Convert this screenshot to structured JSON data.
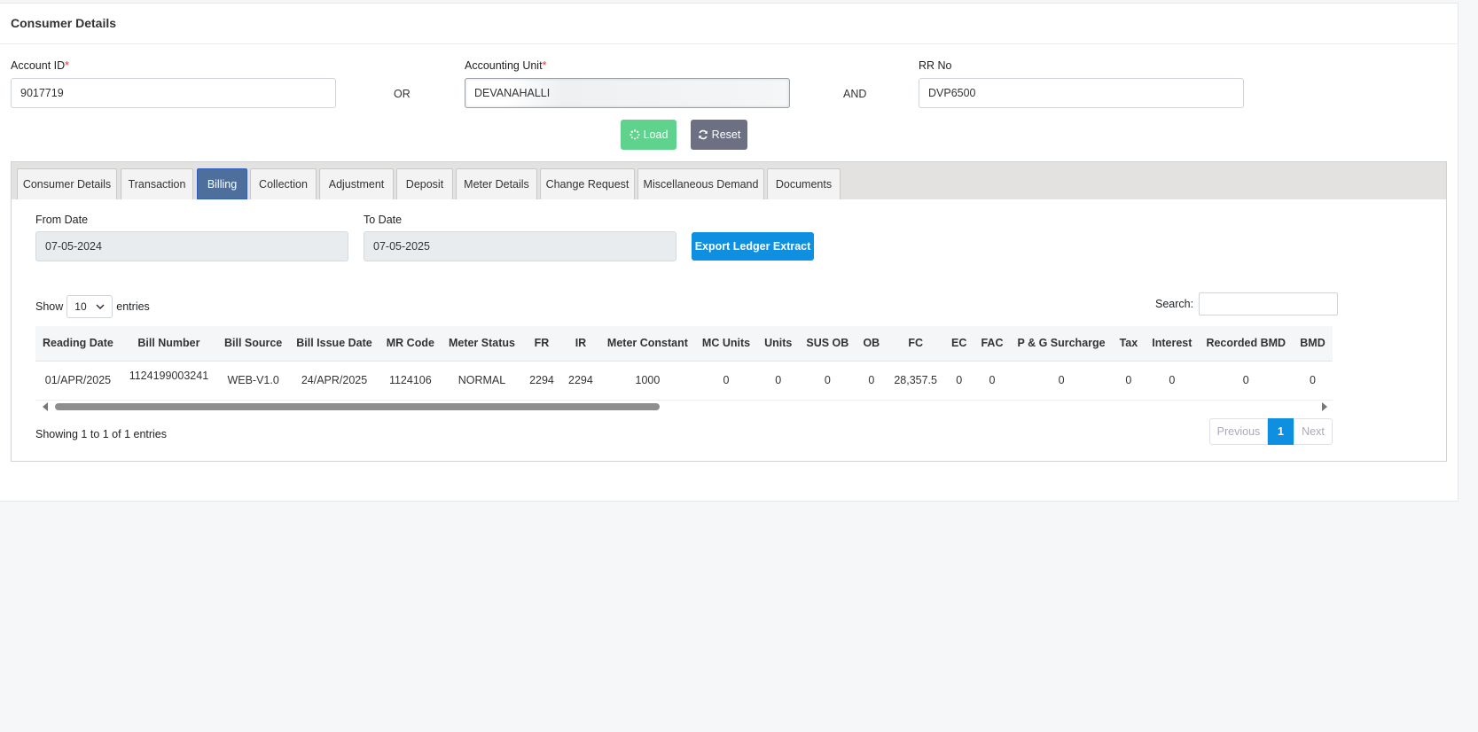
{
  "header": {
    "title": "Consumer Details"
  },
  "form": {
    "account_id": {
      "label": "Account ID",
      "required": "*",
      "value": "9017719"
    },
    "or_label": "OR",
    "accounting_unit": {
      "label": "Accounting Unit",
      "required": "*",
      "value": "DEVANAHALLI"
    },
    "and_label": "AND",
    "rr_no": {
      "label": "RR No",
      "value": "DVP6500"
    },
    "load_label": "Load",
    "reset_label": "Reset"
  },
  "tabs": [
    {
      "label": "Consumer Details"
    },
    {
      "label": "Transaction"
    },
    {
      "label": "Billing",
      "active": true
    },
    {
      "label": "Collection"
    },
    {
      "label": "Adjustment"
    },
    {
      "label": "Deposit"
    },
    {
      "label": "Meter Details"
    },
    {
      "label": "Change Request"
    },
    {
      "label": "Miscellaneous Demand"
    },
    {
      "label": "Documents"
    }
  ],
  "billing": {
    "from_date_label": "From Date",
    "from_date": "07-05-2024",
    "to_date_label": "To Date",
    "to_date": "07-05-2025",
    "export_label": "Export Ledger Extract",
    "show_label": "Show",
    "page_size": "10",
    "entries_label": "entries",
    "search_label": "Search:",
    "columns": [
      "Reading Date",
      "Bill Number",
      "Bill Source",
      "Bill Issue Date",
      "MR Code",
      "Meter Status",
      "FR",
      "IR",
      "Meter Constant",
      "MC Units",
      "Units",
      "SUS OB",
      "OB",
      "FC",
      "EC",
      "FAC",
      "P & G Surcharge",
      "Tax",
      "Interest",
      "Recorded BMD",
      "BMD"
    ],
    "rows": [
      [
        "01/APR/2025",
        "1124199003241",
        "WEB-V1.0",
        "24/APR/2025",
        "1124106",
        "NORMAL",
        "2294",
        "2294",
        "1000",
        "0",
        "0",
        "0",
        "0",
        "28,357.5",
        "0",
        "0",
        "0",
        "0",
        "0",
        "0",
        "0"
      ]
    ],
    "info": "Showing 1 to 1 of 1 entries",
    "pagination": {
      "previous": "Previous",
      "current": "1",
      "next": "Next"
    }
  },
  "colors": {
    "load": "#5fd38d",
    "reset": "#6c7082",
    "active_tab": "#4e6f9c",
    "primary": "#0e8fe0"
  }
}
